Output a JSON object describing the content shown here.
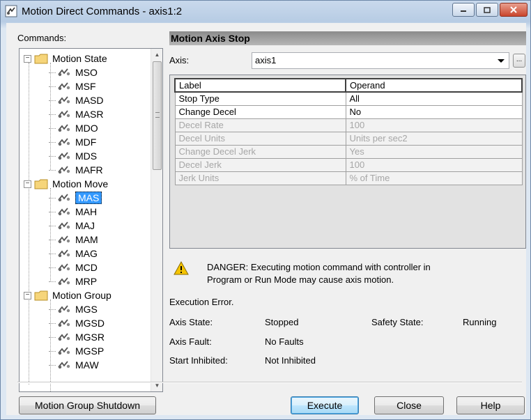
{
  "window": {
    "title": "Motion Direct Commands - axis1:2",
    "app_icon": "motion-axis-icon",
    "buttons": [
      "minimize",
      "maximize",
      "close"
    ]
  },
  "commands_label": "Commands:",
  "tree": {
    "groups": [
      {
        "label": "Motion State",
        "expanded": true,
        "items": [
          "MSO",
          "MSF",
          "MASD",
          "MASR",
          "MDO",
          "MDF",
          "MDS",
          "MAFR"
        ]
      },
      {
        "label": "Motion Move",
        "expanded": true,
        "items": [
          "MAS",
          "MAH",
          "MAJ",
          "MAM",
          "MAG",
          "MCD",
          "MRP"
        ]
      },
      {
        "label": "Motion Group",
        "expanded": true,
        "items": [
          "MGS",
          "MGSD",
          "MGSR",
          "MGSP",
          "MAW"
        ]
      }
    ],
    "selected": "MAS"
  },
  "panel": {
    "title": "Motion Axis Stop",
    "axis_label": "Axis:",
    "axis_value": "axis1",
    "ellipsis": "...",
    "table": {
      "headers": [
        "Label",
        "Operand"
      ],
      "rows": [
        {
          "label": "Stop Type",
          "operand": "All",
          "enabled": true
        },
        {
          "label": "Change Decel",
          "operand": "No",
          "enabled": true
        },
        {
          "label": "Decel Rate",
          "operand": "100",
          "enabled": false
        },
        {
          "label": "Decel Units",
          "operand": "Units per sec2",
          "enabled": false
        },
        {
          "label": "Change Decel Jerk",
          "operand": "Yes",
          "enabled": false
        },
        {
          "label": "Decel Jerk",
          "operand": "100",
          "enabled": false
        },
        {
          "label": "Jerk Units",
          "operand": "% of Time",
          "enabled": false
        }
      ]
    },
    "warning": {
      "line1": "DANGER: Executing motion command with controller in",
      "line2": "Program or Run Mode may cause axis motion."
    },
    "execution_error": "Execution Error.",
    "status": {
      "axis_state_label": "Axis State:",
      "axis_state_value": "Stopped",
      "safety_state_label": "Safety State:",
      "safety_state_value": "Running",
      "axis_fault_label": "Axis Fault:",
      "axis_fault_value": "No Faults",
      "start_inhibited_label": "Start Inhibited:",
      "start_inhibited_value": "Not Inhibited"
    }
  },
  "buttons": {
    "shutdown": "Motion Group Shutdown",
    "execute": "Execute",
    "close": "Close",
    "help": "Help"
  },
  "colors": {
    "selection": "#3399ff",
    "header_band": "#9a9a9a",
    "warning_yellow": "#f5c400"
  }
}
